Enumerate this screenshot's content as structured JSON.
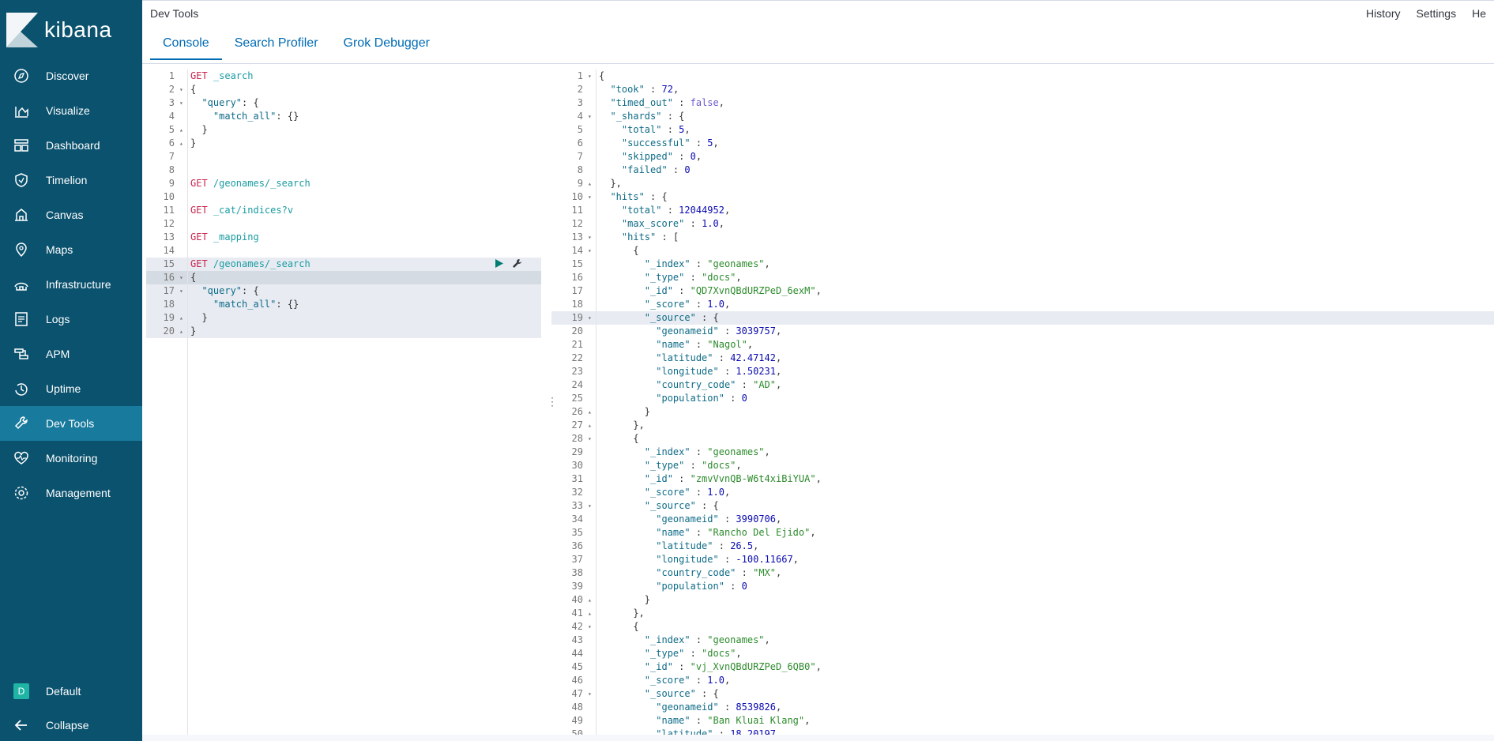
{
  "brand": "kibana",
  "app_title": "Dev Tools",
  "header_links": [
    "History",
    "Settings",
    "He"
  ],
  "tabs": [
    {
      "label": "Console",
      "active": true
    },
    {
      "label": "Search Profiler",
      "active": false
    },
    {
      "label": "Grok Debugger",
      "active": false
    }
  ],
  "nav": [
    {
      "label": "Discover",
      "icon": "compass-icon"
    },
    {
      "label": "Visualize",
      "icon": "chart-icon"
    },
    {
      "label": "Dashboard",
      "icon": "dashboard-icon"
    },
    {
      "label": "Timelion",
      "icon": "shield-icon"
    },
    {
      "label": "Canvas",
      "icon": "canvas-icon"
    },
    {
      "label": "Maps",
      "icon": "map-pin-icon"
    },
    {
      "label": "Infrastructure",
      "icon": "infrastructure-icon"
    },
    {
      "label": "Logs",
      "icon": "logs-icon"
    },
    {
      "label": "APM",
      "icon": "apm-icon"
    },
    {
      "label": "Uptime",
      "icon": "uptime-icon"
    },
    {
      "label": "Dev Tools",
      "icon": "wrench-icon",
      "active": true
    },
    {
      "label": "Monitoring",
      "icon": "heartbeat-icon"
    },
    {
      "label": "Management",
      "icon": "gear-icon"
    }
  ],
  "space": {
    "badge": "D",
    "label": "Default"
  },
  "collapse_label": "Collapse",
  "colors": {
    "sidebar": "#0b526e",
    "sidebar_active": "#187a9d",
    "accent": "#006bb4"
  },
  "request_lines": [
    [
      [
        "kw",
        "GET "
      ],
      [
        "url",
        "_search"
      ]
    ],
    [
      [
        "p",
        "{"
      ]
    ],
    [
      [
        "p",
        "  "
      ],
      [
        "k",
        "\"query\""
      ],
      [
        "p",
        ": {"
      ]
    ],
    [
      [
        "p",
        "    "
      ],
      [
        "k",
        "\"match_all\""
      ],
      [
        "p",
        ": {}"
      ]
    ],
    [
      [
        "p",
        "  }"
      ]
    ],
    [
      [
        "p",
        "}"
      ]
    ],
    [],
    [],
    [
      [
        "kw",
        "GET "
      ],
      [
        "url",
        "/geonames/_search"
      ]
    ],
    [],
    [
      [
        "kw",
        "GET "
      ],
      [
        "url",
        "_cat/indices?v"
      ]
    ],
    [],
    [
      [
        "kw",
        "GET "
      ],
      [
        "url",
        "_mapping"
      ]
    ],
    [],
    [
      [
        "kw",
        "GET "
      ],
      [
        "url",
        "/geonames/_search"
      ]
    ],
    [
      [
        "p",
        "{"
      ]
    ],
    [
      [
        "p",
        "  "
      ],
      [
        "k",
        "\"query\""
      ],
      [
        "p",
        ": {"
      ]
    ],
    [
      [
        "p",
        "    "
      ],
      [
        "k",
        "\"match_all\""
      ],
      [
        "p",
        ": {}"
      ]
    ],
    [
      [
        "p",
        "  }"
      ]
    ],
    [
      [
        "p",
        "}"
      ]
    ]
  ],
  "request_folds": {
    "2": "▾",
    "3": "▾",
    "5": "▴",
    "6": "▴",
    "16": "▾",
    "17": "▾",
    "19": "▴",
    "20": "▴"
  },
  "response_lines": [
    [
      [
        "p",
        "{"
      ]
    ],
    [
      [
        "p",
        "  "
      ],
      [
        "k",
        "\"took\""
      ],
      [
        "p",
        " : "
      ],
      [
        "n",
        "72"
      ],
      [
        "p",
        ","
      ]
    ],
    [
      [
        "p",
        "  "
      ],
      [
        "k",
        "\"timed_out\""
      ],
      [
        "p",
        " : "
      ],
      [
        "b",
        "false"
      ],
      [
        "p",
        ","
      ]
    ],
    [
      [
        "p",
        "  "
      ],
      [
        "k",
        "\"_shards\""
      ],
      [
        "p",
        " : {"
      ]
    ],
    [
      [
        "p",
        "    "
      ],
      [
        "k",
        "\"total\""
      ],
      [
        "p",
        " : "
      ],
      [
        "n",
        "5"
      ],
      [
        "p",
        ","
      ]
    ],
    [
      [
        "p",
        "    "
      ],
      [
        "k",
        "\"successful\""
      ],
      [
        "p",
        " : "
      ],
      [
        "n",
        "5"
      ],
      [
        "p",
        ","
      ]
    ],
    [
      [
        "p",
        "    "
      ],
      [
        "k",
        "\"skipped\""
      ],
      [
        "p",
        " : "
      ],
      [
        "n",
        "0"
      ],
      [
        "p",
        ","
      ]
    ],
    [
      [
        "p",
        "    "
      ],
      [
        "k",
        "\"failed\""
      ],
      [
        "p",
        " : "
      ],
      [
        "n",
        "0"
      ]
    ],
    [
      [
        "p",
        "  },"
      ]
    ],
    [
      [
        "p",
        "  "
      ],
      [
        "k",
        "\"hits\""
      ],
      [
        "p",
        " : {"
      ]
    ],
    [
      [
        "p",
        "    "
      ],
      [
        "k",
        "\"total\""
      ],
      [
        "p",
        " : "
      ],
      [
        "n",
        "12044952"
      ],
      [
        "p",
        ","
      ]
    ],
    [
      [
        "p",
        "    "
      ],
      [
        "k",
        "\"max_score\""
      ],
      [
        "p",
        " : "
      ],
      [
        "n",
        "1.0"
      ],
      [
        "p",
        ","
      ]
    ],
    [
      [
        "p",
        "    "
      ],
      [
        "k",
        "\"hits\""
      ],
      [
        "p",
        " : ["
      ]
    ],
    [
      [
        "p",
        "      {"
      ]
    ],
    [
      [
        "p",
        "        "
      ],
      [
        "k",
        "\"_index\""
      ],
      [
        "p",
        " : "
      ],
      [
        "s",
        "\"geonames\""
      ],
      [
        "p",
        ","
      ]
    ],
    [
      [
        "p",
        "        "
      ],
      [
        "k",
        "\"_type\""
      ],
      [
        "p",
        " : "
      ],
      [
        "s",
        "\"docs\""
      ],
      [
        "p",
        ","
      ]
    ],
    [
      [
        "p",
        "        "
      ],
      [
        "k",
        "\"_id\""
      ],
      [
        "p",
        " : "
      ],
      [
        "s",
        "\"QD7XvnQBdURZPeD_6exM\""
      ],
      [
        "p",
        ","
      ]
    ],
    [
      [
        "p",
        "        "
      ],
      [
        "k",
        "\"_score\""
      ],
      [
        "p",
        " : "
      ],
      [
        "n",
        "1.0"
      ],
      [
        "p",
        ","
      ]
    ],
    [
      [
        "p",
        "        "
      ],
      [
        "k",
        "\"_source\""
      ],
      [
        "p",
        " : {"
      ]
    ],
    [
      [
        "p",
        "          "
      ],
      [
        "k",
        "\"geonameid\""
      ],
      [
        "p",
        " : "
      ],
      [
        "n",
        "3039757"
      ],
      [
        "p",
        ","
      ]
    ],
    [
      [
        "p",
        "          "
      ],
      [
        "k",
        "\"name\""
      ],
      [
        "p",
        " : "
      ],
      [
        "s",
        "\"Nagol\""
      ],
      [
        "p",
        ","
      ]
    ],
    [
      [
        "p",
        "          "
      ],
      [
        "k",
        "\"latitude\""
      ],
      [
        "p",
        " : "
      ],
      [
        "n",
        "42.47142"
      ],
      [
        "p",
        ","
      ]
    ],
    [
      [
        "p",
        "          "
      ],
      [
        "k",
        "\"longitude\""
      ],
      [
        "p",
        " : "
      ],
      [
        "n",
        "1.50231"
      ],
      [
        "p",
        ","
      ]
    ],
    [
      [
        "p",
        "          "
      ],
      [
        "k",
        "\"country_code\""
      ],
      [
        "p",
        " : "
      ],
      [
        "s",
        "\"AD\""
      ],
      [
        "p",
        ","
      ]
    ],
    [
      [
        "p",
        "          "
      ],
      [
        "k",
        "\"population\""
      ],
      [
        "p",
        " : "
      ],
      [
        "n",
        "0"
      ]
    ],
    [
      [
        "p",
        "        }"
      ]
    ],
    [
      [
        "p",
        "      },"
      ]
    ],
    [
      [
        "p",
        "      {"
      ]
    ],
    [
      [
        "p",
        "        "
      ],
      [
        "k",
        "\"_index\""
      ],
      [
        "p",
        " : "
      ],
      [
        "s",
        "\"geonames\""
      ],
      [
        "p",
        ","
      ]
    ],
    [
      [
        "p",
        "        "
      ],
      [
        "k",
        "\"_type\""
      ],
      [
        "p",
        " : "
      ],
      [
        "s",
        "\"docs\""
      ],
      [
        "p",
        ","
      ]
    ],
    [
      [
        "p",
        "        "
      ],
      [
        "k",
        "\"_id\""
      ],
      [
        "p",
        " : "
      ],
      [
        "s",
        "\"zmvVvnQB-W6t4xiBiYUA\""
      ],
      [
        "p",
        ","
      ]
    ],
    [
      [
        "p",
        "        "
      ],
      [
        "k",
        "\"_score\""
      ],
      [
        "p",
        " : "
      ],
      [
        "n",
        "1.0"
      ],
      [
        "p",
        ","
      ]
    ],
    [
      [
        "p",
        "        "
      ],
      [
        "k",
        "\"_source\""
      ],
      [
        "p",
        " : {"
      ]
    ],
    [
      [
        "p",
        "          "
      ],
      [
        "k",
        "\"geonameid\""
      ],
      [
        "p",
        " : "
      ],
      [
        "n",
        "3990706"
      ],
      [
        "p",
        ","
      ]
    ],
    [
      [
        "p",
        "          "
      ],
      [
        "k",
        "\"name\""
      ],
      [
        "p",
        " : "
      ],
      [
        "s",
        "\"Rancho Del Ejido\""
      ],
      [
        "p",
        ","
      ]
    ],
    [
      [
        "p",
        "          "
      ],
      [
        "k",
        "\"latitude\""
      ],
      [
        "p",
        " : "
      ],
      [
        "n",
        "26.5"
      ],
      [
        "p",
        ","
      ]
    ],
    [
      [
        "p",
        "          "
      ],
      [
        "k",
        "\"longitude\""
      ],
      [
        "p",
        " : "
      ],
      [
        "n",
        "-100.11667"
      ],
      [
        "p",
        ","
      ]
    ],
    [
      [
        "p",
        "          "
      ],
      [
        "k",
        "\"country_code\""
      ],
      [
        "p",
        " : "
      ],
      [
        "s",
        "\"MX\""
      ],
      [
        "p",
        ","
      ]
    ],
    [
      [
        "p",
        "          "
      ],
      [
        "k",
        "\"population\""
      ],
      [
        "p",
        " : "
      ],
      [
        "n",
        "0"
      ]
    ],
    [
      [
        "p",
        "        }"
      ]
    ],
    [
      [
        "p",
        "      },"
      ]
    ],
    [
      [
        "p",
        "      {"
      ]
    ],
    [
      [
        "p",
        "        "
      ],
      [
        "k",
        "\"_index\""
      ],
      [
        "p",
        " : "
      ],
      [
        "s",
        "\"geonames\""
      ],
      [
        "p",
        ","
      ]
    ],
    [
      [
        "p",
        "        "
      ],
      [
        "k",
        "\"_type\""
      ],
      [
        "p",
        " : "
      ],
      [
        "s",
        "\"docs\""
      ],
      [
        "p",
        ","
      ]
    ],
    [
      [
        "p",
        "        "
      ],
      [
        "k",
        "\"_id\""
      ],
      [
        "p",
        " : "
      ],
      [
        "s",
        "\"vj_XvnQBdURZPeD_6QB0\""
      ],
      [
        "p",
        ","
      ]
    ],
    [
      [
        "p",
        "        "
      ],
      [
        "k",
        "\"_score\""
      ],
      [
        "p",
        " : "
      ],
      [
        "n",
        "1.0"
      ],
      [
        "p",
        ","
      ]
    ],
    [
      [
        "p",
        "        "
      ],
      [
        "k",
        "\"_source\""
      ],
      [
        "p",
        " : {"
      ]
    ],
    [
      [
        "p",
        "          "
      ],
      [
        "k",
        "\"geonameid\""
      ],
      [
        "p",
        " : "
      ],
      [
        "n",
        "8539826"
      ],
      [
        "p",
        ","
      ]
    ],
    [
      [
        "p",
        "          "
      ],
      [
        "k",
        "\"name\""
      ],
      [
        "p",
        " : "
      ],
      [
        "s",
        "\"Ban Kluai Klang\""
      ],
      [
        "p",
        ","
      ]
    ],
    [
      [
        "p",
        "          "
      ],
      [
        "k",
        "\"latitude\""
      ],
      [
        "p",
        " : "
      ],
      [
        "n",
        "18.20197"
      ],
      [
        "p",
        ","
      ]
    ]
  ],
  "response_folds": {
    "1": "▾",
    "4": "▾",
    "9": "▴",
    "10": "▾",
    "13": "▾",
    "14": "▾",
    "19": "▾",
    "26": "▴",
    "27": "▴",
    "28": "▾",
    "33": "▾",
    "40": "▴",
    "41": "▴",
    "42": "▾",
    "47": "▾"
  }
}
